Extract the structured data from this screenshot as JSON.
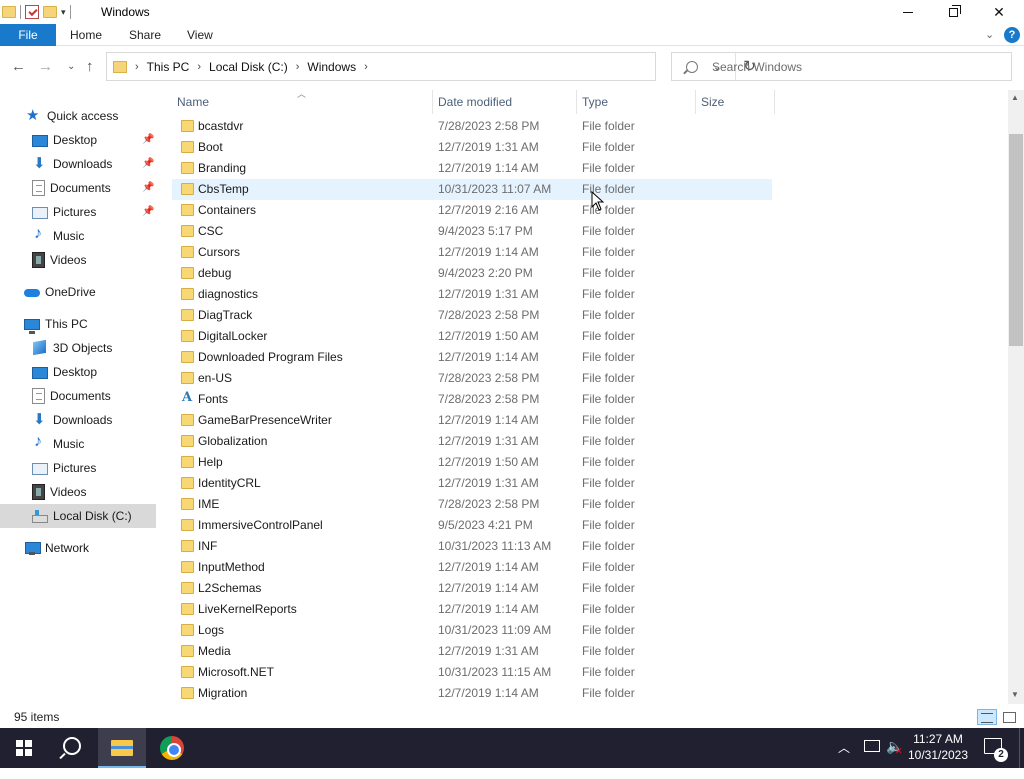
{
  "window": {
    "title": "Windows",
    "minimize_icon": "minimize-icon",
    "maximize_icon": "restore-icon",
    "close_glyph": "✕"
  },
  "ribbon": {
    "file": "File",
    "tabs": [
      "Home",
      "Share",
      "View"
    ],
    "help": "?"
  },
  "address": {
    "crumbs": [
      "This PC",
      "Local Disk (C:)",
      "Windows"
    ],
    "separator": "›"
  },
  "search": {
    "placeholder": "Search Windows"
  },
  "sidebar": {
    "items": [
      {
        "label": "Quick access",
        "icon": "star-icon",
        "pinned": false,
        "level": 0
      },
      {
        "label": "Desktop",
        "icon": "desktop-icon",
        "pinned": true,
        "level": 1
      },
      {
        "label": "Downloads",
        "icon": "downloads-icon",
        "pinned": true,
        "level": 1
      },
      {
        "label": "Documents",
        "icon": "documents-icon",
        "pinned": true,
        "level": 1
      },
      {
        "label": "Pictures",
        "icon": "pictures-icon",
        "pinned": true,
        "level": 1
      },
      {
        "label": "Music",
        "icon": "music-icon",
        "pinned": false,
        "level": 1
      },
      {
        "label": "Videos",
        "icon": "videos-icon",
        "pinned": false,
        "level": 1
      },
      {
        "label": "OneDrive",
        "icon": "onedrive-icon",
        "pinned": false,
        "level": 0
      },
      {
        "label": "This PC",
        "icon": "this-pc-icon",
        "pinned": false,
        "level": 0
      },
      {
        "label": "3D Objects",
        "icon": "3d-objects-icon",
        "pinned": false,
        "level": 1
      },
      {
        "label": "Desktop",
        "icon": "desktop-icon",
        "pinned": false,
        "level": 1
      },
      {
        "label": "Documents",
        "icon": "documents-icon",
        "pinned": false,
        "level": 1
      },
      {
        "label": "Downloads",
        "icon": "downloads-icon",
        "pinned": false,
        "level": 1
      },
      {
        "label": "Music",
        "icon": "music-icon",
        "pinned": false,
        "level": 1
      },
      {
        "label": "Pictures",
        "icon": "pictures-icon",
        "pinned": false,
        "level": 1
      },
      {
        "label": "Videos",
        "icon": "videos-icon",
        "pinned": false,
        "level": 1
      },
      {
        "label": "Local Disk (C:)",
        "icon": "local-disk-icon",
        "pinned": false,
        "level": 1,
        "selected": true
      },
      {
        "label": "Network",
        "icon": "network-icon",
        "pinned": false,
        "level": 0
      }
    ]
  },
  "columns": {
    "name": "Name",
    "date": "Date modified",
    "type": "Type",
    "size": "Size"
  },
  "files": [
    {
      "name": "bcastdvr",
      "date": "7/28/2023 2:58 PM",
      "type": "File folder",
      "size": ""
    },
    {
      "name": "Boot",
      "date": "12/7/2019 1:31 AM",
      "type": "File folder",
      "size": ""
    },
    {
      "name": "Branding",
      "date": "12/7/2019 1:14 AM",
      "type": "File folder",
      "size": ""
    },
    {
      "name": "CbsTemp",
      "date": "10/31/2023 11:07 AM",
      "type": "File folder",
      "size": "",
      "hover": true
    },
    {
      "name": "Containers",
      "date": "12/7/2019 2:16 AM",
      "type": "File folder",
      "size": ""
    },
    {
      "name": "CSC",
      "date": "9/4/2023 5:17 PM",
      "type": "File folder",
      "size": ""
    },
    {
      "name": "Cursors",
      "date": "12/7/2019 1:14 AM",
      "type": "File folder",
      "size": ""
    },
    {
      "name": "debug",
      "date": "9/4/2023 2:20 PM",
      "type": "File folder",
      "size": ""
    },
    {
      "name": "diagnostics",
      "date": "12/7/2019 1:31 AM",
      "type": "File folder",
      "size": ""
    },
    {
      "name": "DiagTrack",
      "date": "7/28/2023 2:58 PM",
      "type": "File folder",
      "size": ""
    },
    {
      "name": "DigitalLocker",
      "date": "12/7/2019 1:50 AM",
      "type": "File folder",
      "size": ""
    },
    {
      "name": "Downloaded Program Files",
      "date": "12/7/2019 1:14 AM",
      "type": "File folder",
      "size": ""
    },
    {
      "name": "en-US",
      "date": "7/28/2023 2:58 PM",
      "type": "File folder",
      "size": ""
    },
    {
      "name": "Fonts",
      "date": "7/28/2023 2:58 PM",
      "type": "File folder",
      "size": "",
      "icon": "fonts-folder-icon"
    },
    {
      "name": "GameBarPresenceWriter",
      "date": "12/7/2019 1:14 AM",
      "type": "File folder",
      "size": ""
    },
    {
      "name": "Globalization",
      "date": "12/7/2019 1:31 AM",
      "type": "File folder",
      "size": ""
    },
    {
      "name": "Help",
      "date": "12/7/2019 1:50 AM",
      "type": "File folder",
      "size": ""
    },
    {
      "name": "IdentityCRL",
      "date": "12/7/2019 1:31 AM",
      "type": "File folder",
      "size": ""
    },
    {
      "name": "IME",
      "date": "7/28/2023 2:58 PM",
      "type": "File folder",
      "size": ""
    },
    {
      "name": "ImmersiveControlPanel",
      "date": "9/5/2023 4:21 PM",
      "type": "File folder",
      "size": ""
    },
    {
      "name": "INF",
      "date": "10/31/2023 11:13 AM",
      "type": "File folder",
      "size": ""
    },
    {
      "name": "InputMethod",
      "date": "12/7/2019 1:14 AM",
      "type": "File folder",
      "size": ""
    },
    {
      "name": "L2Schemas",
      "date": "12/7/2019 1:14 AM",
      "type": "File folder",
      "size": ""
    },
    {
      "name": "LiveKernelReports",
      "date": "12/7/2019 1:14 AM",
      "type": "File folder",
      "size": ""
    },
    {
      "name": "Logs",
      "date": "10/31/2023 11:09 AM",
      "type": "File folder",
      "size": ""
    },
    {
      "name": "Media",
      "date": "12/7/2019 1:31 AM",
      "type": "File folder",
      "size": ""
    },
    {
      "name": "Microsoft.NET",
      "date": "10/31/2023 11:15 AM",
      "type": "File folder",
      "size": ""
    },
    {
      "name": "Migration",
      "date": "12/7/2019 1:14 AM",
      "type": "File folder",
      "size": ""
    }
  ],
  "status": {
    "item_count": "95 items"
  },
  "taskbar": {
    "time": "11:27 AM",
    "date": "10/31/2023",
    "notification_count": "2",
    "apps": [
      "start-icon",
      "search-icon",
      "file-explorer-icon",
      "chrome-icon"
    ]
  }
}
